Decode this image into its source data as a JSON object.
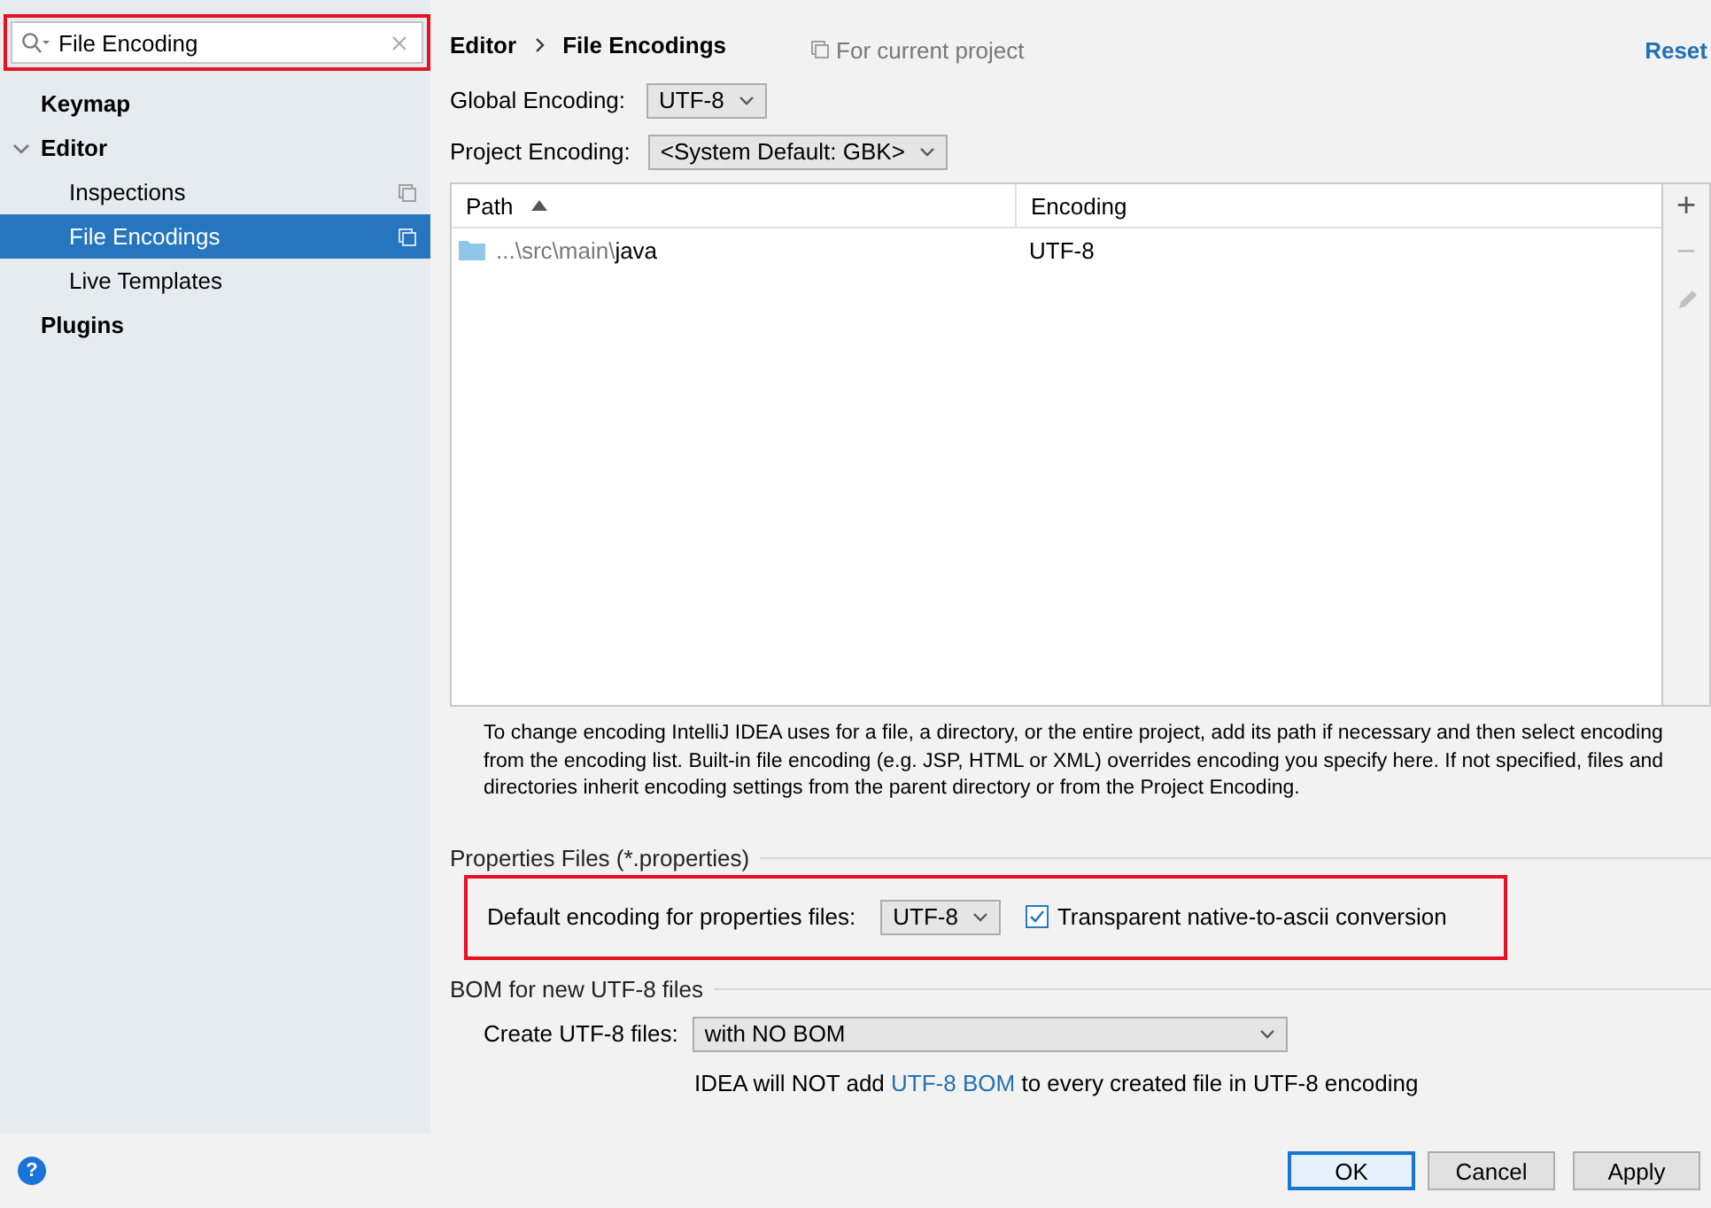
{
  "search": {
    "value": "File Encoding",
    "highlighted": true
  },
  "sidebar": {
    "items": [
      {
        "label": "Keymap",
        "selected": false,
        "project_level": false
      },
      {
        "label": "Editor",
        "selected": false,
        "expanded": true,
        "project_level": false,
        "children": [
          {
            "label": "Inspections",
            "selected": false,
            "project_level": true
          },
          {
            "label": "File Encodings",
            "selected": true,
            "project_level": true
          },
          {
            "label": "Live Templates",
            "selected": false,
            "project_level": false
          }
        ]
      },
      {
        "label": "Plugins",
        "selected": false,
        "project_level": false
      }
    ]
  },
  "breadcrumb": [
    "Editor",
    "File Encodings"
  ],
  "scope_note": "For current project",
  "reset_link": "Reset",
  "global_encoding": {
    "label": "Global Encoding:",
    "value": "UTF-8"
  },
  "project_encoding": {
    "label": "Project Encoding:",
    "value": "<System Default: GBK>"
  },
  "table": {
    "columns": [
      {
        "label": "Path",
        "sorted": true
      },
      {
        "label": "Encoding",
        "sorted": false
      }
    ],
    "rows": [
      {
        "path_prefix": "...\\src\\main\\",
        "path_name": "java",
        "encoding": "UTF-8"
      }
    ]
  },
  "table_tools": [
    {
      "kind": "add",
      "label": "+",
      "disabled": false
    },
    {
      "kind": "remove",
      "label": "−",
      "disabled": true
    },
    {
      "kind": "edit",
      "disabled": true
    }
  ],
  "help_text": "To change encoding IntelliJ IDEA uses for a file, a directory, or the entire project, add its path if necessary and then select encoding from the encoding list. Built-in file encoding (e.g. JSP, HTML or XML) overrides encoding you specify here. If not specified, files and directories inherit encoding settings from the parent directory or from the Project Encoding.",
  "properties_section": {
    "title": "Properties Files (*.properties)",
    "highlighted": true,
    "default_label": "Default encoding for properties files:",
    "default_value": "UTF-8",
    "native_to_ascii": {
      "label": "Transparent native-to-ascii conversion",
      "checked": true
    }
  },
  "bom_section": {
    "title": "BOM for new UTF-8 files",
    "create_label": "Create UTF-8 files:",
    "create_value": "with NO BOM",
    "note_before": "IDEA will NOT add ",
    "note_link": "UTF-8 BOM",
    "note_after": " to every created file in UTF-8 encoding"
  },
  "help_button": "?",
  "buttons": [
    {
      "label": "OK",
      "default": true
    },
    {
      "label": "Cancel",
      "default": false
    },
    {
      "label": "Apply",
      "default": false
    }
  ]
}
